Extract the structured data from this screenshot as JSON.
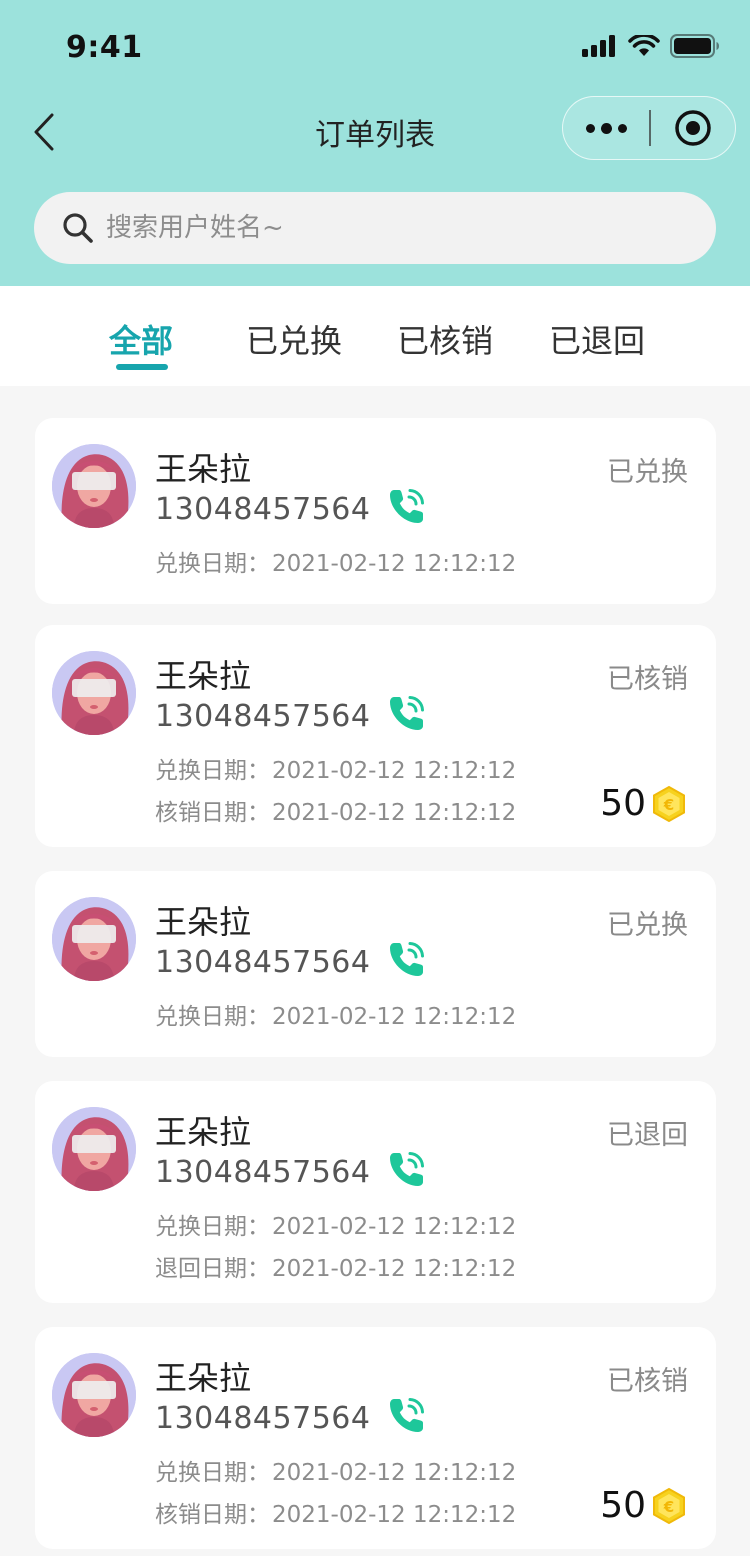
{
  "status_bar": {
    "time": "9:41"
  },
  "nav": {
    "title": "订单列表"
  },
  "search": {
    "placeholder": "搜索用户姓名~"
  },
  "tabs": [
    {
      "label": "全部",
      "active": true
    },
    {
      "label": "已兑换",
      "active": false
    },
    {
      "label": "已核销",
      "active": false
    },
    {
      "label": "已退回",
      "active": false
    }
  ],
  "labels": {
    "exchange_date": "兑换日期：",
    "verify_date": "核销日期：",
    "return_date": "退回日期："
  },
  "orders": [
    {
      "name": "王朵拉",
      "phone": "13048457564",
      "status": "已兑换",
      "exchange_date": "2021-02-12 12:12:12"
    },
    {
      "name": "王朵拉",
      "phone": "13048457564",
      "status": "已核销",
      "exchange_date": "2021-02-12 12:12:12",
      "verify_date": "2021-02-12 12:12:12",
      "points": "50"
    },
    {
      "name": "王朵拉",
      "phone": "13048457564",
      "status": "已兑换",
      "exchange_date": "2021-02-12 12:12:12"
    },
    {
      "name": "王朵拉",
      "phone": "13048457564",
      "status": "已退回",
      "exchange_date": "2021-02-12 12:12:12",
      "return_date": "2021-02-12 12:12:12"
    },
    {
      "name": "王朵拉",
      "phone": "13048457564",
      "status": "已核销",
      "exchange_date": "2021-02-12 12:12:12",
      "verify_date": "2021-02-12 12:12:12",
      "points": "50"
    }
  ],
  "colors": {
    "header_bg": "#9ce2dc",
    "accent": "#17a5ad",
    "phone_icon": "#1ec79a",
    "coin": "#f7d21e"
  },
  "icons": {
    "back": "chevron-left-icon",
    "more": "more-dots-icon",
    "target": "target-icon",
    "search": "search-icon",
    "phone": "phone-call-icon",
    "coin": "coin-icon"
  }
}
